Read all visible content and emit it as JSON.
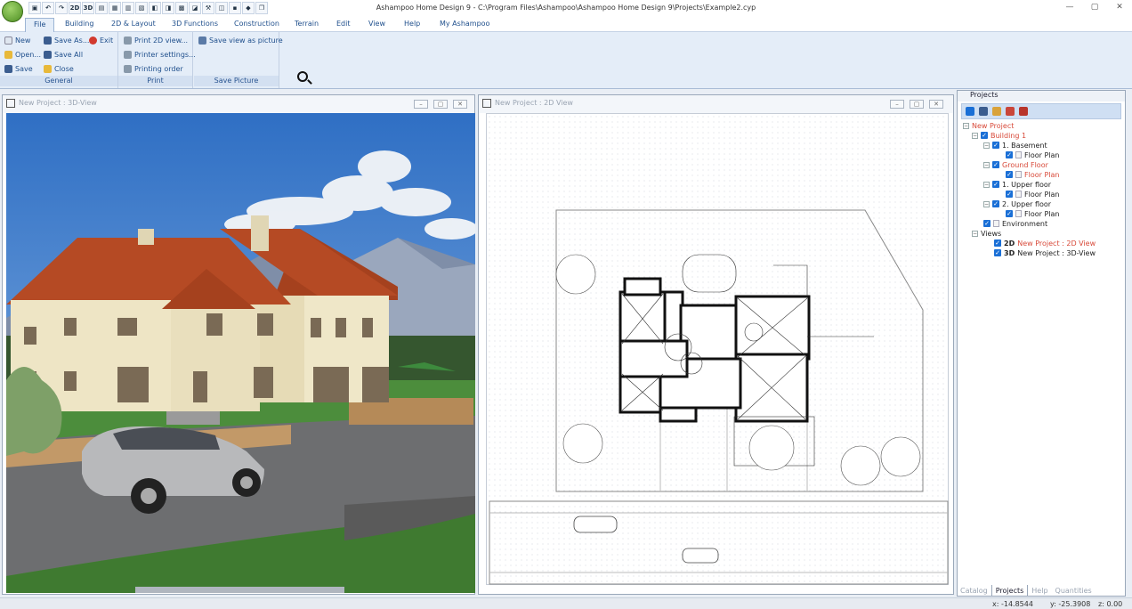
{
  "window": {
    "title": "Ashampoo Home Design 9 - C:\\Program Files\\Ashampoo\\Ashampoo Home Design 9\\Projects\\Example2.cyp",
    "minimize": "—",
    "maximize": "▢",
    "close": "✕"
  },
  "quick_access": [
    "▣",
    "↶",
    "↷",
    "2D",
    "3D",
    "▤",
    "▦",
    "▥",
    "▧",
    "◧",
    "◨",
    "▩",
    "◪",
    "⚒",
    "◫",
    "▪",
    "◆",
    "❐"
  ],
  "menu": {
    "tabs": [
      "File",
      "Building",
      "2D & Layout",
      "3D Functions",
      "Construction",
      "Terrain",
      "Edit",
      "View",
      "Help",
      "My Ashampoo"
    ]
  },
  "ribbon": {
    "general": {
      "label": "General",
      "new": "New",
      "open": "Open...",
      "save": "Save",
      "save_as": "Save As...",
      "save_all": "Save All",
      "close": "Close",
      "exit": "Exit"
    },
    "print": {
      "label": "Print",
      "print_2d": "Print 2D view...",
      "printer_settings": "Printer settings...",
      "printing_order": "Printing order"
    },
    "save_picture": {
      "label": "Save Picture",
      "save_view": "Save view as picture"
    }
  },
  "view3d": {
    "title": "New Project : 3D-View"
  },
  "view2d": {
    "title": "New Project : 2D View"
  },
  "projects": {
    "title": "Projects",
    "tree": {
      "root": "New Project",
      "building": "Building 1",
      "basement": "1. Basement",
      "floor_plan": "Floor Plan",
      "ground_floor": "Ground Floor",
      "upper1": "1. Upper floor",
      "upper2": "2. Upper floor",
      "environment": "Environment",
      "views": "Views",
      "view2d_tag": "2D",
      "view2d": "New Project : 2D View",
      "view3d_tag": "3D",
      "view3d": "New Project : 3D-View"
    }
  },
  "panel_tabs": [
    "Catalog",
    "Projects",
    "Help",
    "Quantities"
  ],
  "status": {
    "x": "x: -14.8544",
    "y": "y: -25.3908",
    "z": "z: 0.00"
  }
}
